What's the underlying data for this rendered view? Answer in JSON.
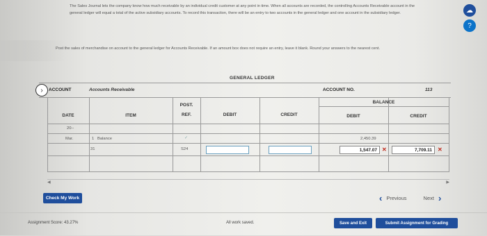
{
  "instructions": "The Sales Journal lets the company know how much receivable by an individual credit customer at any point in time. When all accounts are recorded, the controlling Accounts Receivable account in the general ledger will equal a total of the active subsidiary accounts. To record this transaction, there will be an entry to two accounts in the general ledger and one account in the subsidiary ledger.",
  "question": "Post the sales of merchandise on account to the general ledger for Accounts Receivable. If an amount box does not require an entry, leave it blank. Round your answers to the nearest cent.",
  "ledger": {
    "title": "GENERAL LEDGER",
    "account_label": "ACCOUNT",
    "account_name": "Accounts Receivable",
    "account_no_label": "ACCOUNT NO.",
    "account_no": "113"
  },
  "table": {
    "headers": {
      "date": "DATE",
      "item": "ITEM",
      "post": "POST.",
      "ref": "REF.",
      "debit": "DEBIT",
      "credit": "CREDIT",
      "balance": "BALANCE",
      "bal_debit": "DEBIT",
      "bal_credit": "CREDIT"
    },
    "year": "20--",
    "row1": {
      "month": "Mar.",
      "day": "1",
      "item": "Balance",
      "post_ref": "✓",
      "bal_debit": "2,450.39"
    },
    "row2": {
      "day": "31",
      "post_ref": "S24",
      "debit": "",
      "credit": "",
      "bal_debit": "1,547.07",
      "bal_credit": "7,709.11"
    }
  },
  "buttons": {
    "check": "Check My Work",
    "previous": "Previous",
    "next": "Next",
    "save_exit": "Save and Exit",
    "submit": "Submit Assignment for Grading"
  },
  "footer": {
    "score": "Assignment Score:  43.27%",
    "saved": "All work saved."
  },
  "icons": {
    "side1": "cloud-icon",
    "side2": "help-icon",
    "wrong": "x-mark-icon",
    "next": "chevron-right-icon",
    "prev": "chevron-left-icon",
    "arrow": "chevron-right-circle-icon"
  },
  "colors": {
    "primary": "#1f4e9c",
    "error": "#c0281b"
  }
}
